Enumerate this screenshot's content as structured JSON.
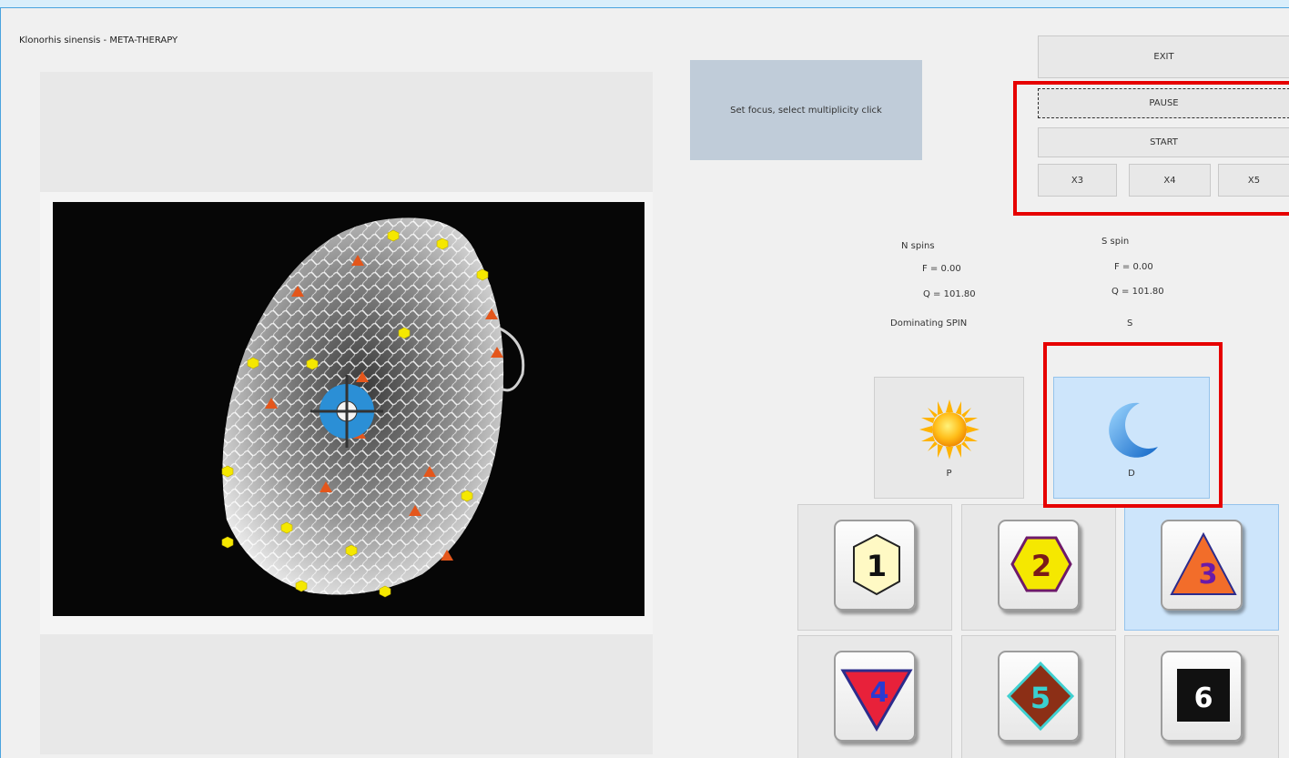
{
  "window": {
    "title": "Klonorhis sinensis - META-THERAPY"
  },
  "info_box": {
    "text": "Set focus, select multiplicity click"
  },
  "controls": {
    "exit": "EXIT",
    "pause": "PAUSE",
    "start": "START",
    "x3": "X3",
    "x4": "X4",
    "x5": "X5"
  },
  "spins": {
    "n_title": "N spins",
    "n_f": "F =  0.00",
    "n_q": "Q = 101.80",
    "s_title": "S spin",
    "s_f": "F =  0.00",
    "s_q": "Q = 101.80",
    "dominating_label": "Dominating SPIN",
    "dominating_value": "S"
  },
  "spin_buttons": {
    "p_label": "P",
    "d_label": "D"
  },
  "tiles": [
    "1",
    "2",
    "3",
    "4",
    "5",
    "6"
  ],
  "colors": {
    "highlight": "#e60000",
    "selected": "#cde5fb",
    "target": "#2b8fd6",
    "marker_yellow": "#f5e800",
    "marker_orange": "#e4561b"
  },
  "icons": [
    "sun-icon",
    "moon-icon",
    "crosshair-icon",
    "hexagon-1-icon",
    "hexagon-2-icon",
    "triangle-3-icon",
    "triangle-4-icon",
    "diamond-5-icon",
    "square-6-icon"
  ]
}
